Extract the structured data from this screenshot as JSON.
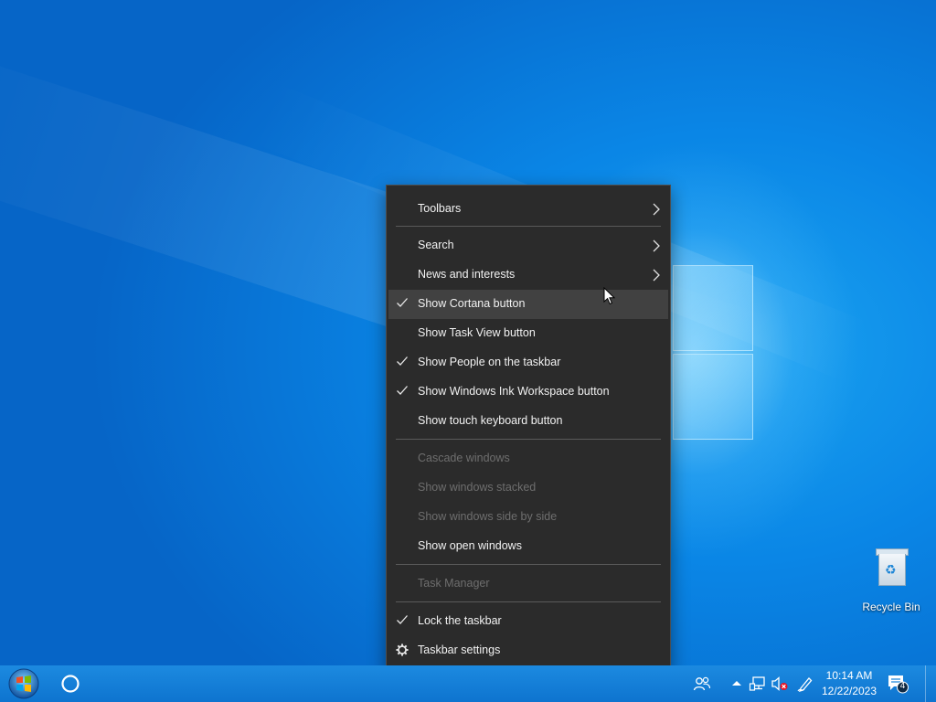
{
  "desktop": {
    "icons": [
      {
        "label": "Recycle Bin",
        "icon": "recycle-bin-icon"
      }
    ]
  },
  "context_menu": {
    "items": [
      {
        "id": "toolbars",
        "label": "Toolbars",
        "submenu": true,
        "enabled": true
      },
      {
        "id": "search",
        "label": "Search",
        "submenu": true,
        "enabled": true
      },
      {
        "id": "news",
        "label": "News and interests",
        "submenu": true,
        "enabled": true
      },
      {
        "id": "cortana",
        "label": "Show Cortana button",
        "checked": true,
        "hovered": true,
        "enabled": true
      },
      {
        "id": "taskview",
        "label": "Show Task View button",
        "checked": false,
        "enabled": true
      },
      {
        "id": "people",
        "label": "Show People on the taskbar",
        "checked": true,
        "enabled": true
      },
      {
        "id": "ink",
        "label": "Show Windows Ink Workspace button",
        "checked": true,
        "enabled": true
      },
      {
        "id": "touchkb",
        "label": "Show touch keyboard button",
        "checked": false,
        "enabled": true
      },
      {
        "id": "cascade",
        "label": "Cascade windows",
        "enabled": false
      },
      {
        "id": "stacked",
        "label": "Show windows stacked",
        "enabled": false
      },
      {
        "id": "sidebyside",
        "label": "Show windows side by side",
        "enabled": false
      },
      {
        "id": "openwin",
        "label": "Show open windows",
        "enabled": true
      },
      {
        "id": "taskmgr",
        "label": "Task Manager",
        "enabled": false
      },
      {
        "id": "lock",
        "label": "Lock the taskbar",
        "checked": true,
        "enabled": true
      },
      {
        "id": "settings",
        "label": "Taskbar settings",
        "icon": "gear-icon",
        "enabled": true
      }
    ]
  },
  "taskbar": {
    "start_icon": "windows-start-orb-icon",
    "cortana_icon": "cortana-circle-icon",
    "tray_icons": [
      "people-icon",
      "show-hidden-icons-chevron-icon",
      "network-icon",
      "volume-muted-icon",
      "windows-ink-pen-icon"
    ],
    "clock": {
      "time": "10:14 AM",
      "date": "12/22/2023"
    },
    "notifications": {
      "count": "4",
      "icon": "action-center-icon"
    }
  },
  "colors": {
    "menu_bg": "#2b2b2b",
    "menu_hover": "#414141",
    "menu_text": "#f2f2f2",
    "menu_disabled_text": "#6e6e6e",
    "taskbar": "#1480d8"
  }
}
